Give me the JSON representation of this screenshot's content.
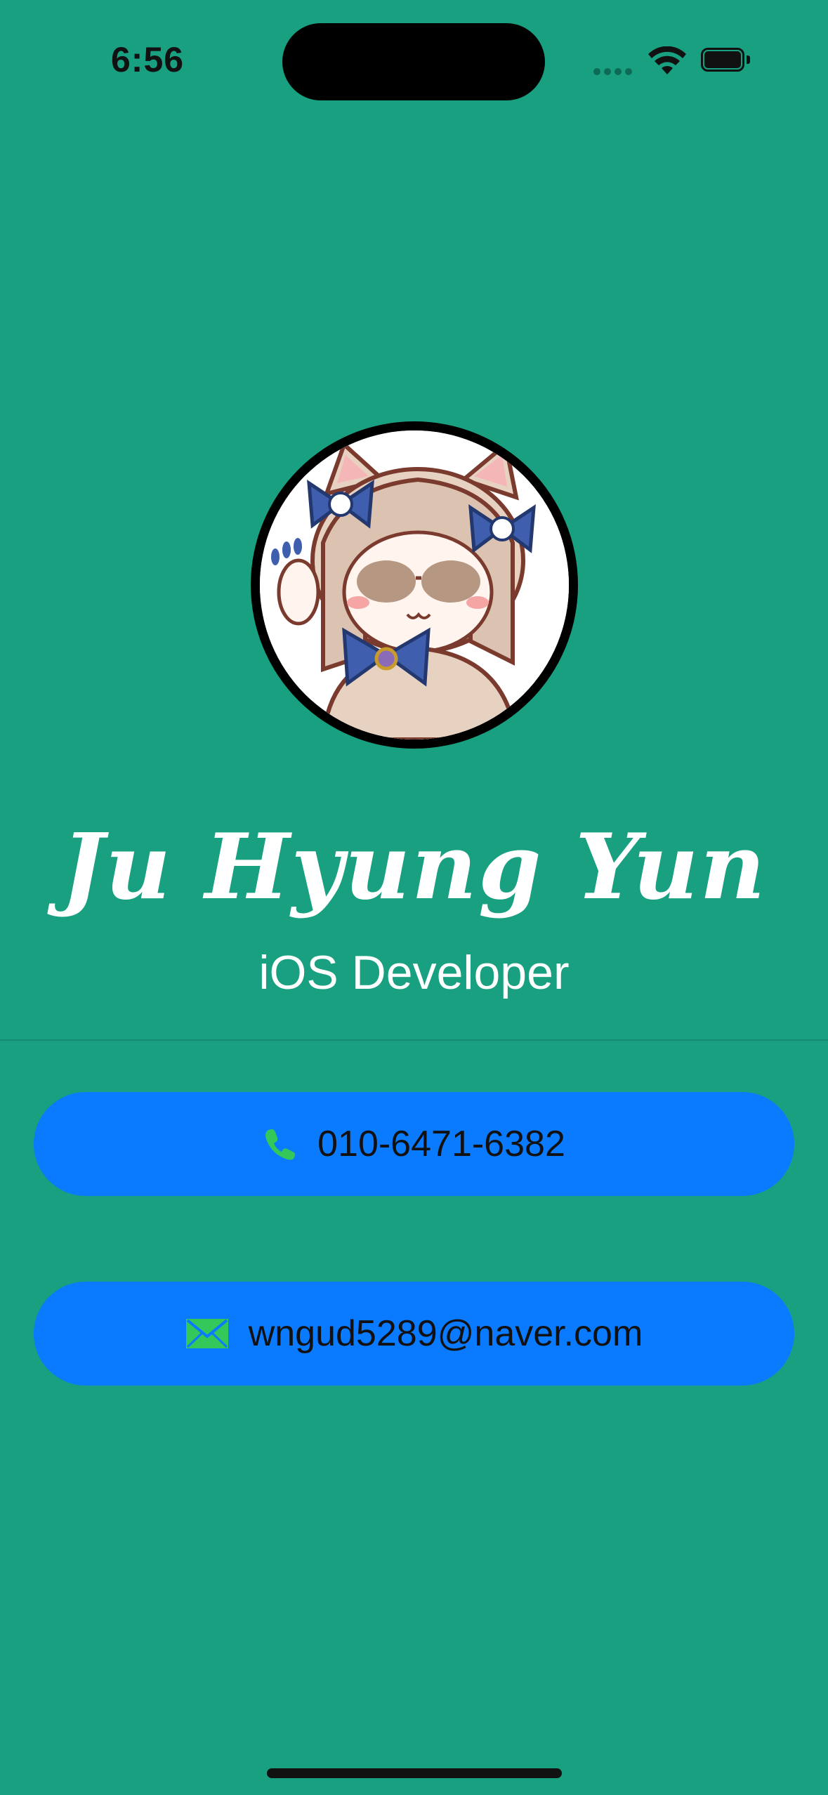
{
  "status_bar": {
    "time": "6:56"
  },
  "profile": {
    "name": "Ju Hyung Yun",
    "role": "iOS Developer"
  },
  "contacts": {
    "phone": "010-6471-6382",
    "email": "wngud5289@naver.com"
  },
  "icons": {
    "phone": "phone-icon",
    "email": "envelope-icon",
    "wifi": "wifi-icon",
    "battery": "battery-icon"
  },
  "colors": {
    "background": "#19a081",
    "button": "#0a7aff",
    "icon_green": "#34c759"
  }
}
